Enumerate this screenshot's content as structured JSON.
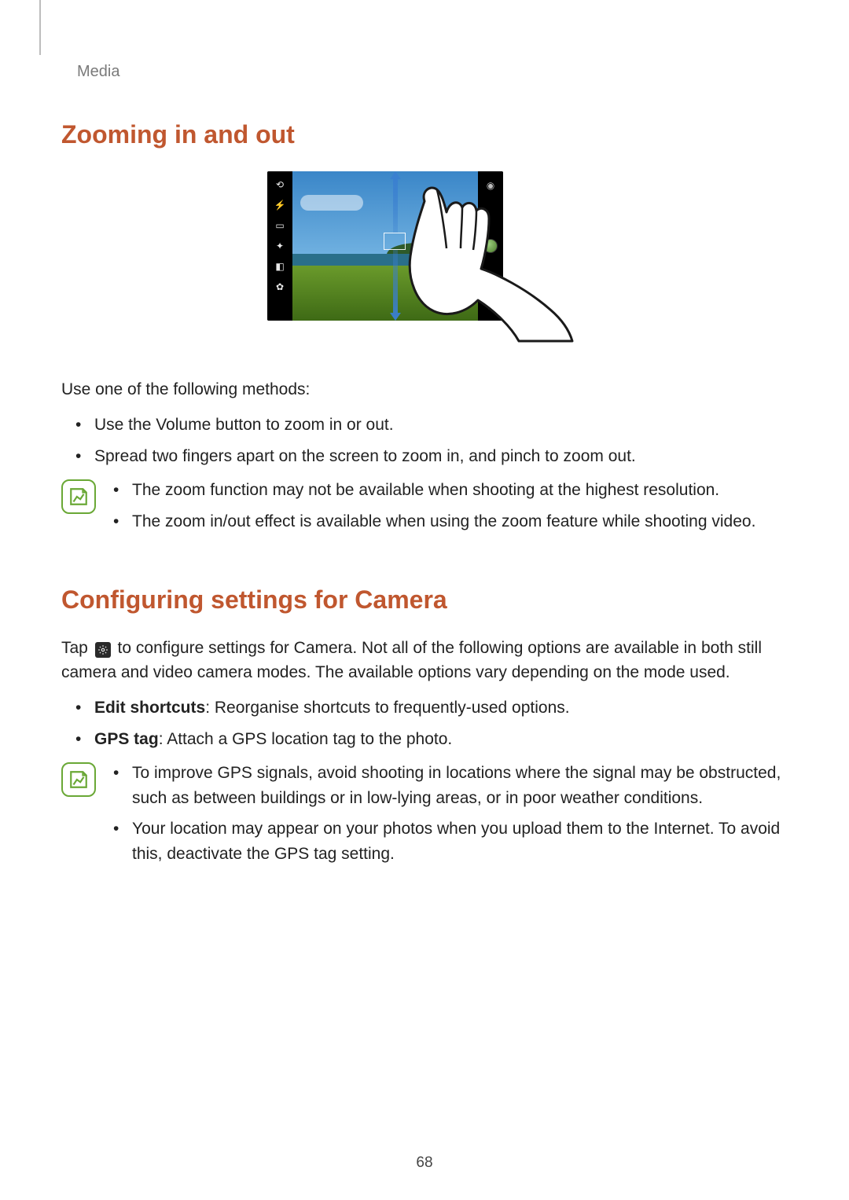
{
  "breadcrumb": "Media",
  "page_number": "68",
  "section1": {
    "heading": "Zooming in and out",
    "intro": "Use one of the following methods:",
    "bullets": [
      "Use the Volume button to zoom in or out.",
      "Spread two fingers apart on the screen to zoom in, and pinch to zoom out."
    ],
    "note_bullets": [
      "The zoom function may not be available when shooting at the highest resolution.",
      "The zoom in/out effect is available when using the zoom feature while shooting video."
    ]
  },
  "section2": {
    "heading": "Configuring settings for Camera",
    "intro_pre": "Tap ",
    "intro_post": " to configure settings for Camera. Not all of the following options are available in both still camera and video camera modes. The available options vary depending on the mode used.",
    "bullets": [
      {
        "label": "Edit shortcuts",
        "text": ": Reorganise shortcuts to frequently-used options."
      },
      {
        "label": "GPS tag",
        "text": ": Attach a GPS location tag to the photo."
      }
    ],
    "note_bullets": [
      "To improve GPS signals, avoid shooting in locations where the signal may be obstructed, such as between buildings or in low-lying areas, or in poor weather conditions.",
      "Your location may appear on your photos when you upload them to the Internet. To avoid this, deactivate the GPS tag setting."
    ]
  }
}
